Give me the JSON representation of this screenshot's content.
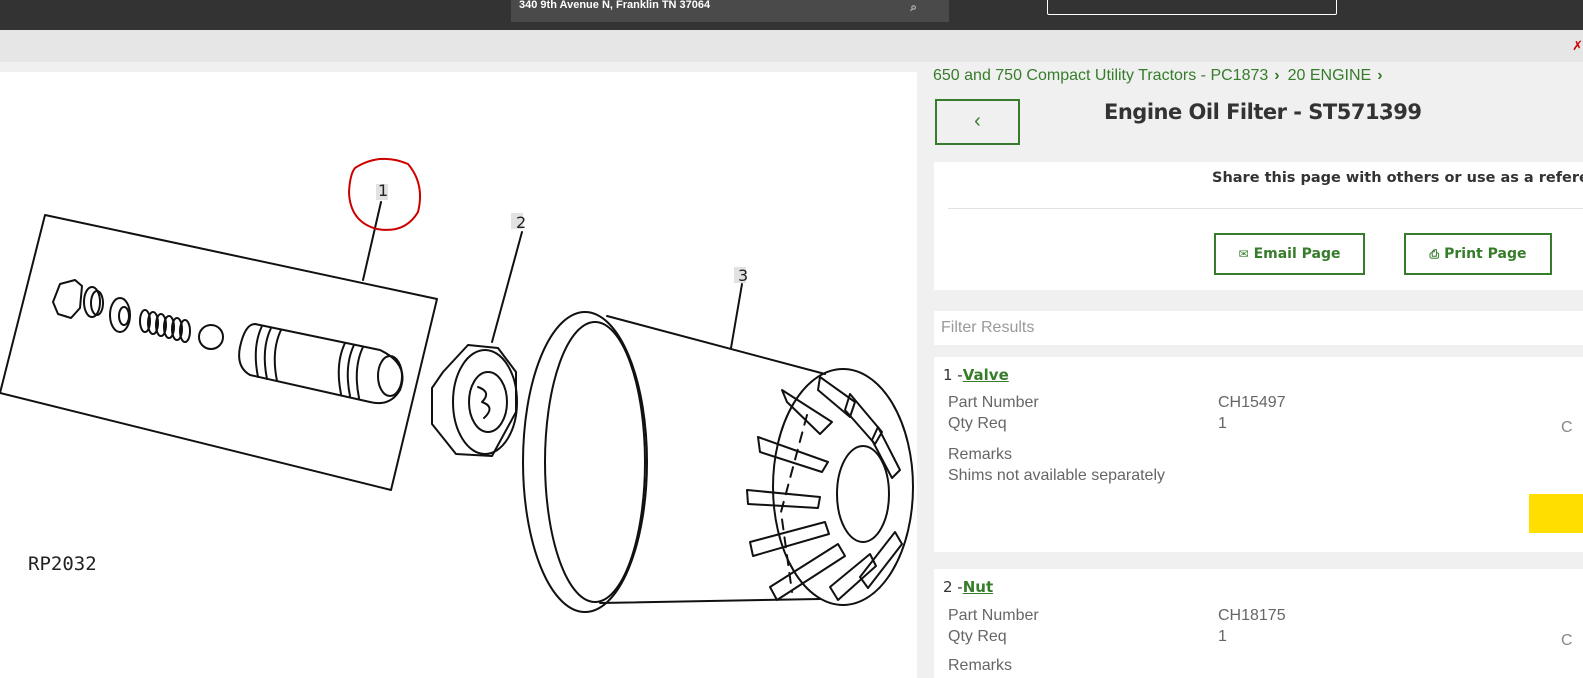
{
  "header": {
    "location": "340 9th Avenue N, Franklin TN 37064",
    "corner_mark": "✗"
  },
  "diagram": {
    "callouts": [
      "1",
      "2",
      "3"
    ],
    "drawing_id": "RP2032"
  },
  "breadcrumb": {
    "items": [
      "650 and 750 Compact Utility Tractors - PC1873",
      "20 ENGINE"
    ],
    "separator": "›"
  },
  "title": {
    "back_label": "‹",
    "text": "Engine Oil Filter - ST571399",
    "chevron": "⌄"
  },
  "share": {
    "text": "Share this page with others or use as a reference.",
    "email_label": "Email Page",
    "print_label": "Print Page",
    "email_icon": "envelope-icon",
    "print_icon": "printer-icon"
  },
  "filter": {
    "placeholder": "Filter Results"
  },
  "parts": [
    {
      "number": "1 -",
      "name": "Valve",
      "part_number_label": "Part Number",
      "part_number": "CH15497",
      "qty_label": "Qty Req",
      "qty": "1",
      "remarks_label": "Remarks",
      "remarks": "Shims not available separately",
      "cut_text": "C"
    },
    {
      "number": "2 -",
      "name": "Nut",
      "part_number_label": "Part Number",
      "part_number": "CH18175",
      "qty_label": "Qty Req",
      "qty": "1",
      "remarks_label": "Remarks",
      "cut_text": "C"
    }
  ],
  "colors": {
    "brand_green": "#367c2b",
    "cart_yellow": "#ffde00",
    "annotation_red": "#cc0000"
  }
}
